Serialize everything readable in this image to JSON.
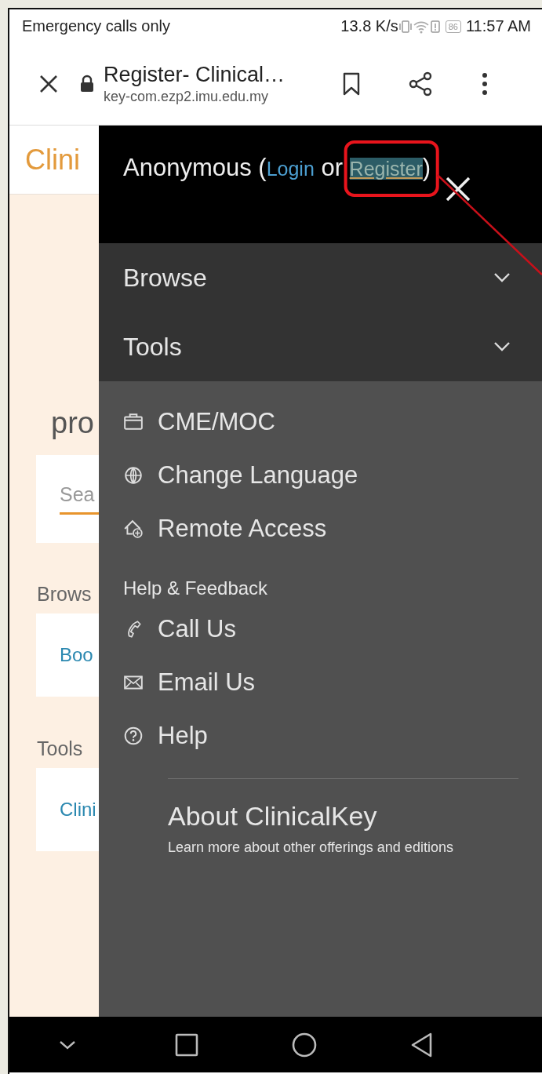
{
  "status_bar": {
    "carrier": "Emergency calls only",
    "speed": "13.8 K/s",
    "battery": "86",
    "time": "11:57 AM"
  },
  "browser_bar": {
    "title": "Register- Clinical…",
    "url": "key-com.ezp2.imu.edu.my"
  },
  "page": {
    "logo": "Clini",
    "heading": "pro",
    "search": {
      "placeholder": "Sea"
    },
    "sections": [
      {
        "title": "Brows",
        "link": "Boo"
      },
      {
        "title": "Tools",
        "link": "Clini"
      }
    ]
  },
  "drawer": {
    "account": [
      {
        "kind": "text",
        "text": "Anonymous ("
      },
      {
        "kind": "link",
        "text": "Login",
        "highlighted": false
      },
      {
        "kind": "text",
        "text": " or "
      },
      {
        "kind": "link",
        "text": "Register",
        "highlighted": true
      },
      {
        "kind": "text",
        "text": ")"
      }
    ],
    "sections": [
      {
        "label": "Browse",
        "expanded": false
      },
      {
        "label": "Tools",
        "expanded": false
      }
    ],
    "items": [
      {
        "kind": "briefcase",
        "label": "CME/MOC"
      },
      {
        "kind": "globe",
        "label": "Change Language"
      },
      {
        "kind": "remote",
        "label": "Remote Access"
      }
    ],
    "help": {
      "title": "Help & Feedback",
      "items": [
        {
          "kind": "phone",
          "label": "Call Us"
        },
        {
          "kind": "mail",
          "label": "Email Us"
        },
        {
          "kind": "question",
          "label": "Help"
        }
      ]
    },
    "about": {
      "title": "About ClinicalKey",
      "subtitle": "Learn more about other offerings and editions"
    }
  }
}
